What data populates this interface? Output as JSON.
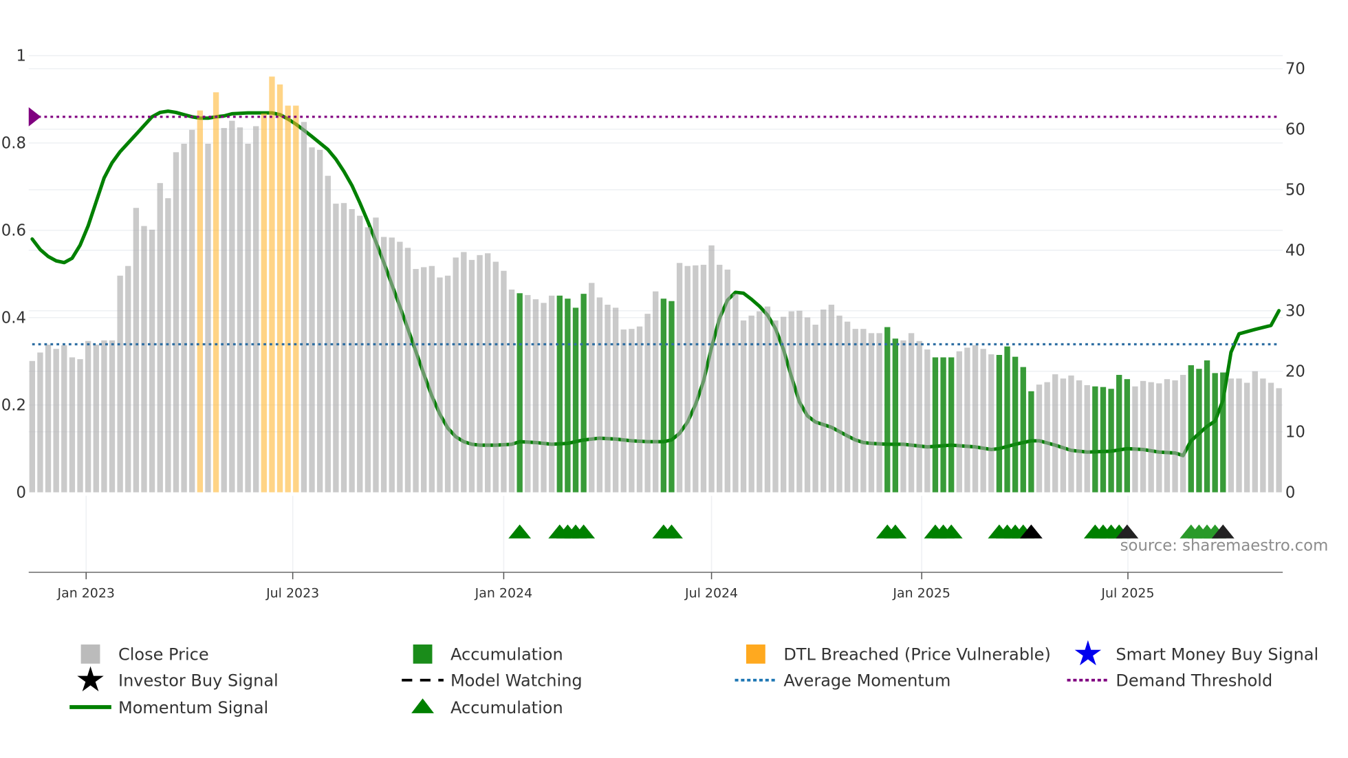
{
  "chart_data": {
    "type": "bar",
    "title": "",
    "source": "source: sharemaestro.com",
    "x_unit": "weeks since first bar",
    "left_axis": {
      "range": [
        0,
        1
      ],
      "ticks": [
        0,
        0.2,
        0.4,
        0.6,
        0.8,
        1
      ],
      "tick_labels": [
        "0",
        "0.2",
        "0.4",
        "0.6",
        "0.8",
        "1"
      ]
    },
    "right_axis": {
      "range": [
        0,
        70
      ],
      "ticks": [
        0,
        10,
        20,
        30,
        40,
        50,
        60,
        70
      ],
      "tick_labels": [
        "0",
        "10",
        "20",
        "30",
        "40",
        "50",
        "60",
        "70"
      ]
    },
    "x_ticks": [
      {
        "label": "Jan 2023",
        "week": 6.75
      },
      {
        "label": "Jul 2023",
        "week": 32.6
      },
      {
        "label": "Jan 2024",
        "week": 59.0
      },
      {
        "label": "Jul 2024",
        "week": 85.0
      },
      {
        "label": "Jan 2025",
        "week": 111.3
      },
      {
        "label": "Jul 2025",
        "week": 137.1
      }
    ],
    "close_price": [
      21.7,
      23.1,
      24.4,
      23.7,
      24.3,
      22.3,
      22.0,
      25.0,
      24.4,
      25.1,
      25.1,
      35.8,
      37.4,
      47.0,
      44.0,
      43.4,
      51.1,
      48.6,
      56.2,
      57.6,
      59.9,
      63.1,
      57.6,
      66.1,
      60.2,
      61.4,
      60.3,
      57.6,
      60.5,
      62.6,
      68.7,
      67.4,
      63.9,
      63.9,
      61.2,
      57.0,
      56.6,
      52.3,
      47.7,
      47.8,
      46.8,
      45.7,
      43.8,
      45.4,
      42.2,
      42.1,
      41.4,
      40.4,
      36.9,
      37.2,
      37.4,
      35.5,
      35.8,
      38.8,
      39.7,
      38.4,
      39.2,
      39.5,
      38.1,
      36.6,
      33.5,
      32.9,
      32.6,
      31.9,
      31.3,
      32.5,
      32.5,
      32.0,
      30.5,
      32.8,
      34.6,
      32.2,
      31.0,
      30.5,
      26.9,
      27.0,
      27.4,
      29.5,
      33.2,
      32.0,
      31.6,
      37.9,
      37.4,
      37.5,
      37.6,
      40.8,
      37.6,
      36.8,
      32.8,
      28.4,
      29.2,
      29.9,
      30.7,
      28.4,
      29.0,
      29.9,
      30.0,
      28.9,
      27.7,
      30.2,
      31.0,
      29.2,
      28.2,
      27.0,
      27.0,
      26.3,
      26.3,
      27.3,
      25.4,
      25.1,
      26.3,
      25.0,
      23.6,
      22.3,
      22.3,
      22.3,
      23.3,
      23.9,
      24.3,
      23.7,
      22.8,
      22.7,
      24.1,
      22.4,
      20.7,
      16.7,
      17.8,
      18.2,
      19.5,
      18.8,
      19.3,
      18.5,
      17.7,
      17.5,
      17.4,
      17.1,
      19.4,
      18.7,
      17.5,
      18.4,
      18.2,
      18.0,
      18.7,
      18.5,
      19.4,
      21.0,
      20.4,
      21.8,
      19.7,
      19.8,
      18.8,
      18.8,
      18.1,
      20.0,
      18.8,
      18.1,
      17.2
    ],
    "accumulation_weeks": [
      61,
      66,
      67,
      68,
      69,
      79,
      80,
      107,
      108,
      113,
      114,
      115,
      121,
      122,
      123,
      124,
      125,
      133,
      134,
      135,
      136,
      137,
      145,
      146,
      147,
      148,
      149
    ],
    "dtl_breached_weeks": [
      21,
      23,
      29,
      30,
      31,
      32,
      33
    ],
    "momentum_signal": [
      [
        0,
        0.58
      ],
      [
        1,
        0.556
      ],
      [
        2,
        0.54
      ],
      [
        3,
        0.53
      ],
      [
        4,
        0.526
      ],
      [
        5,
        0.536
      ],
      [
        6,
        0.566
      ],
      [
        7,
        0.61
      ],
      [
        8,
        0.665
      ],
      [
        9,
        0.72
      ],
      [
        10,
        0.755
      ],
      [
        11,
        0.78
      ],
      [
        12,
        0.8
      ],
      [
        13,
        0.82
      ],
      [
        14,
        0.84
      ],
      [
        15,
        0.86
      ],
      [
        16,
        0.87
      ],
      [
        17,
        0.873
      ],
      [
        18,
        0.87
      ],
      [
        19,
        0.865
      ],
      [
        20,
        0.86
      ],
      [
        21,
        0.857
      ],
      [
        22,
        0.857
      ],
      [
        23,
        0.86
      ],
      [
        24,
        0.862
      ],
      [
        25,
        0.867
      ],
      [
        27,
        0.869
      ],
      [
        29,
        0.869
      ],
      [
        30,
        0.869
      ],
      [
        31,
        0.865
      ],
      [
        32,
        0.855
      ],
      [
        33,
        0.843
      ],
      [
        34,
        0.829
      ],
      [
        35,
        0.815
      ],
      [
        36,
        0.8
      ],
      [
        37,
        0.785
      ],
      [
        38,
        0.763
      ],
      [
        39,
        0.735
      ],
      [
        40,
        0.703
      ],
      [
        41,
        0.663
      ],
      [
        42,
        0.62
      ],
      [
        43,
        0.574
      ],
      [
        44,
        0.526
      ],
      [
        45,
        0.476
      ],
      [
        46,
        0.426
      ],
      [
        47,
        0.375
      ],
      [
        48,
        0.323
      ],
      [
        49,
        0.271
      ],
      [
        50,
        0.221
      ],
      [
        51,
        0.179
      ],
      [
        52,
        0.147
      ],
      [
        53,
        0.127
      ],
      [
        54,
        0.116
      ],
      [
        55,
        0.11
      ],
      [
        56,
        0.108
      ],
      [
        58,
        0.108
      ],
      [
        60,
        0.11
      ],
      [
        61,
        0.116
      ],
      [
        63,
        0.114
      ],
      [
        65,
        0.11
      ],
      [
        67,
        0.112
      ],
      [
        69,
        0.12
      ],
      [
        71,
        0.124
      ],
      [
        73,
        0.122
      ],
      [
        75,
        0.118
      ],
      [
        77,
        0.116
      ],
      [
        79,
        0.116
      ],
      [
        80,
        0.12
      ],
      [
        81,
        0.135
      ],
      [
        82,
        0.161
      ],
      [
        83,
        0.201
      ],
      [
        84,
        0.255
      ],
      [
        85,
        0.331
      ],
      [
        86,
        0.398
      ],
      [
        87,
        0.44
      ],
      [
        88,
        0.458
      ],
      [
        89,
        0.456
      ],
      [
        90,
        0.442
      ],
      [
        91,
        0.426
      ],
      [
        92,
        0.406
      ],
      [
        93,
        0.375
      ],
      [
        94,
        0.327
      ],
      [
        95,
        0.265
      ],
      [
        96,
        0.207
      ],
      [
        97,
        0.175
      ],
      [
        98,
        0.161
      ],
      [
        99,
        0.155
      ],
      [
        100,
        0.149
      ],
      [
        101,
        0.139
      ],
      [
        102,
        0.129
      ],
      [
        103,
        0.12
      ],
      [
        104,
        0.114
      ],
      [
        105,
        0.112
      ],
      [
        107,
        0.11
      ],
      [
        109,
        0.11
      ],
      [
        112,
        0.104
      ],
      [
        115,
        0.108
      ],
      [
        118,
        0.104
      ],
      [
        120,
        0.098
      ],
      [
        121,
        0.1
      ],
      [
        123,
        0.11
      ],
      [
        125,
        0.118
      ],
      [
        126,
        0.118
      ],
      [
        128,
        0.108
      ],
      [
        130,
        0.096
      ],
      [
        132,
        0.092
      ],
      [
        135,
        0.094
      ],
      [
        137,
        0.1
      ],
      [
        139,
        0.098
      ],
      [
        141,
        0.092
      ],
      [
        143,
        0.09
      ],
      [
        144,
        0.084
      ],
      [
        145,
        0.118
      ],
      [
        147,
        0.151
      ],
      [
        148,
        0.163
      ],
      [
        149,
        0.211
      ],
      [
        150,
        0.321
      ],
      [
        151,
        0.363
      ],
      [
        153,
        0.373
      ],
      [
        155,
        0.382
      ],
      [
        156,
        0.416
      ]
    ],
    "average_momentum": 0.339,
    "demand_threshold": 0.86,
    "accumulation_markers": [
      61,
      66,
      67,
      68,
      69,
      79,
      80,
      107,
      108,
      113,
      114,
      115,
      121,
      122,
      123,
      124,
      133,
      134,
      135,
      136,
      145,
      146,
      147,
      148
    ],
    "investor_buy_markers": [
      125,
      137,
      149
    ],
    "legend": [
      {
        "label": "Close Price",
        "symbol": "square",
        "color": "#bbbbbb"
      },
      {
        "label": "Accumulation",
        "symbol": "square",
        "color": "#1a8c1a"
      },
      {
        "label": "DTL Breached (Price Vulnerable)",
        "symbol": "square",
        "color": "#ffa91f"
      },
      {
        "label": "Smart Money Buy Signal",
        "symbol": "star",
        "color": "#0000ee"
      },
      {
        "label": "Investor Buy Signal",
        "symbol": "star",
        "color": "#000000"
      },
      {
        "label": "Model Watching",
        "symbol": "dash",
        "color": "#000000"
      },
      {
        "label": "Average Momentum",
        "symbol": "dot",
        "color": "#1f77b4"
      },
      {
        "label": "Demand Threshold",
        "symbol": "dot",
        "color": "#800080"
      },
      {
        "label": "Momentum Signal",
        "symbol": "line",
        "color": "#008000"
      },
      {
        "label": "Accumulation",
        "symbol": "triangle",
        "color": "#008000"
      }
    ],
    "legend_placement": "bottom"
  }
}
